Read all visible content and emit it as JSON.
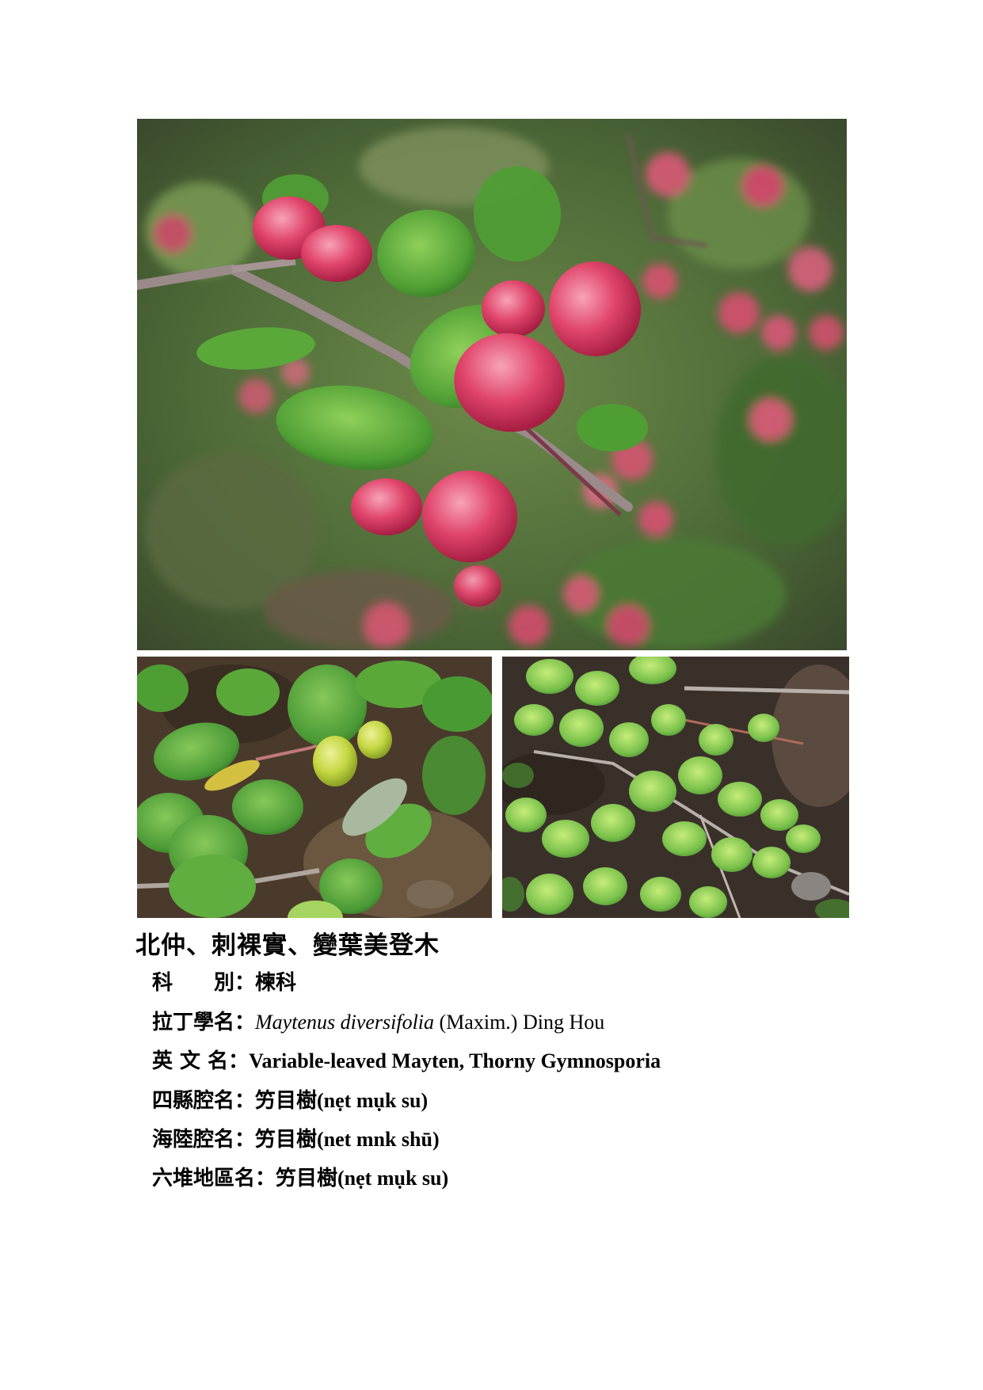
{
  "title": "北仲、刺裸實、變葉美登木",
  "photos": {
    "main": "pink-fruit-branch-photo",
    "bottom_left": "green-fruit-leaves-photo",
    "bottom_right": "thorny-shrub-leaves-photo"
  },
  "info": {
    "family_label": "科　　別：",
    "family_value": "楝科",
    "latin_label": "拉丁學名：",
    "latin_italic": "Maytenus diversifolia",
    "latin_rest": " (Maxim.) Ding Hou",
    "english_label": "英 文 名：",
    "english_value": "Variable-leaved Mayten, Thorny Gymnosporia",
    "sixian_label": "四縣腔名：",
    "sixian_value": "竻目樹(nẹt mụk su)",
    "hailu_label": "海陸腔名：",
    "hailu_value": "竻目樹(net mnk shū)",
    "liudui_label": "六堆地區名：",
    "liudui_value": "竻目樹(nẹt mụk su)"
  },
  "colors": {
    "leaf": "#5aa83a",
    "leaf_light": "#9ed45c",
    "fruit": "#e0446a",
    "fruit_green": "#c9d84a",
    "soil": "#4a3a2c"
  }
}
